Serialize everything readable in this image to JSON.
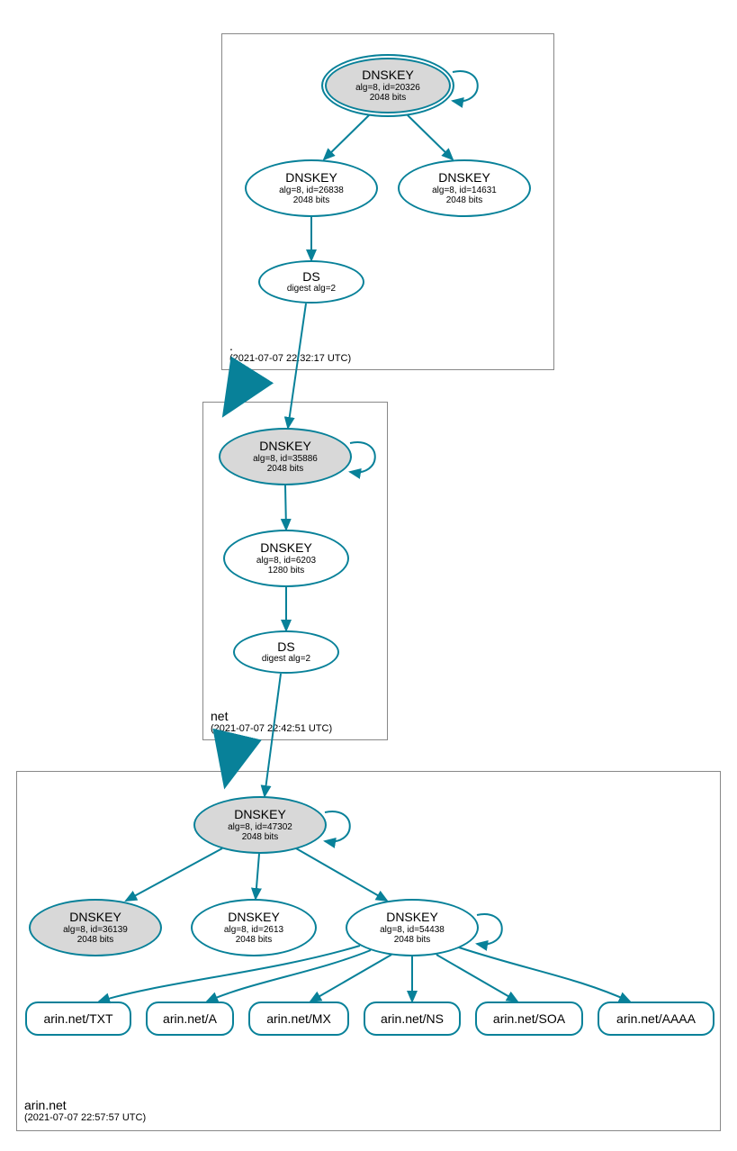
{
  "zones": {
    "root": {
      "name": ".",
      "ts": "(2021-07-07 22:32:17 UTC)"
    },
    "net": {
      "name": "net",
      "ts": "(2021-07-07 22:42:51 UTC)"
    },
    "arin": {
      "name": "arin.net",
      "ts": "(2021-07-07 22:57:57 UTC)"
    }
  },
  "nodes": {
    "root_ksk": {
      "title": "DNSKEY",
      "l1": "alg=8, id=20326",
      "l2": "2048 bits"
    },
    "root_zsk1": {
      "title": "DNSKEY",
      "l1": "alg=8, id=26838",
      "l2": "2048 bits"
    },
    "root_zsk2": {
      "title": "DNSKEY",
      "l1": "alg=8, id=14631",
      "l2": "2048 bits"
    },
    "root_ds": {
      "title": "DS",
      "l1": "digest alg=2"
    },
    "net_ksk": {
      "title": "DNSKEY",
      "l1": "alg=8, id=35886",
      "l2": "2048 bits"
    },
    "net_zsk": {
      "title": "DNSKEY",
      "l1": "alg=8, id=6203",
      "l2": "1280 bits"
    },
    "net_ds": {
      "title": "DS",
      "l1": "digest alg=2"
    },
    "arin_ksk": {
      "title": "DNSKEY",
      "l1": "alg=8, id=47302",
      "l2": "2048 bits"
    },
    "arin_k2": {
      "title": "DNSKEY",
      "l1": "alg=8, id=36139",
      "l2": "2048 bits"
    },
    "arin_k3": {
      "title": "DNSKEY",
      "l1": "alg=8, id=2613",
      "l2": "2048 bits"
    },
    "arin_zsk": {
      "title": "DNSKEY",
      "l1": "alg=8, id=54438",
      "l2": "2048 bits"
    }
  },
  "rrsets": {
    "txt": "arin.net/TXT",
    "a": "arin.net/A",
    "mx": "arin.net/MX",
    "ns": "arin.net/NS",
    "soa": "arin.net/SOA",
    "aaaa": "arin.net/AAAA"
  }
}
